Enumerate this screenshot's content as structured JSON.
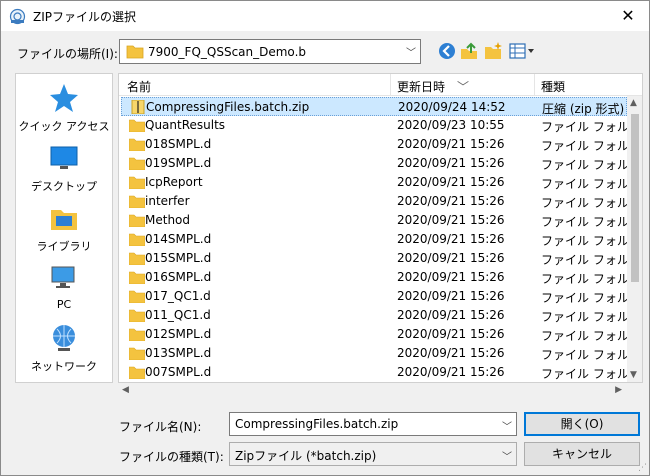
{
  "window": {
    "title": "ZIPファイルの選択",
    "close_glyph": "✕"
  },
  "lookin": {
    "label": "ファイルの場所(I):",
    "value": "7900_FQ_QSScan_Demo.b"
  },
  "places": [
    {
      "label": "クイック アクセス",
      "icon": "star-icon"
    },
    {
      "label": "デスクトップ",
      "icon": "desktop-icon"
    },
    {
      "label": "ライブラリ",
      "icon": "library-icon"
    },
    {
      "label": "PC",
      "icon": "pc-icon"
    },
    {
      "label": "ネットワーク",
      "icon": "network-icon"
    }
  ],
  "columns": {
    "name": "名前",
    "date": "更新日時",
    "type": "種類"
  },
  "files": [
    {
      "name": "CompressingFiles.batch.zip",
      "date": "2020/09/24 14:52",
      "type": "圧縮 (zip 形式) フォ",
      "kind": "zip",
      "selected": true
    },
    {
      "name": "QuantResults",
      "date": "2020/09/23 10:55",
      "type": "ファイル フォルダー",
      "kind": "folder"
    },
    {
      "name": "018SMPL.d",
      "date": "2020/09/21 15:26",
      "type": "ファイル フォルダー",
      "kind": "folder"
    },
    {
      "name": "019SMPL.d",
      "date": "2020/09/21 15:26",
      "type": "ファイル フォルダー",
      "kind": "folder"
    },
    {
      "name": "IcpReport",
      "date": "2020/09/21 15:26",
      "type": "ファイル フォルダー",
      "kind": "folder"
    },
    {
      "name": "interfer",
      "date": "2020/09/21 15:26",
      "type": "ファイル フォルダー",
      "kind": "folder"
    },
    {
      "name": "Method",
      "date": "2020/09/21 15:26",
      "type": "ファイル フォルダー",
      "kind": "folder"
    },
    {
      "name": "014SMPL.d",
      "date": "2020/09/21 15:26",
      "type": "ファイル フォルダー",
      "kind": "folder"
    },
    {
      "name": "015SMPL.d",
      "date": "2020/09/21 15:26",
      "type": "ファイル フォルダー",
      "kind": "folder"
    },
    {
      "name": "016SMPL.d",
      "date": "2020/09/21 15:26",
      "type": "ファイル フォルダー",
      "kind": "folder"
    },
    {
      "name": "017_QC1.d",
      "date": "2020/09/21 15:26",
      "type": "ファイル フォルダー",
      "kind": "folder"
    },
    {
      "name": "011_QC1.d",
      "date": "2020/09/21 15:26",
      "type": "ファイル フォルダー",
      "kind": "folder"
    },
    {
      "name": "012SMPL.d",
      "date": "2020/09/21 15:26",
      "type": "ファイル フォルダー",
      "kind": "folder"
    },
    {
      "name": "013SMPL.d",
      "date": "2020/09/21 15:26",
      "type": "ファイル フォルダー",
      "kind": "folder"
    },
    {
      "name": "007SMPL.d",
      "date": "2020/09/21 15:26",
      "type": "ファイル フォルダー",
      "kind": "folder"
    }
  ],
  "filename": {
    "label": "ファイル名(N):",
    "value": "CompressingFiles.batch.zip"
  },
  "filetype": {
    "label": "ファイルの種類(T):",
    "value": "Zipファイル (*batch.zip)"
  },
  "buttons": {
    "open": "開く(O)",
    "cancel": "キャンセル"
  },
  "colors": {
    "selection": "#cce8ff",
    "folder": "#f4c33f",
    "accent": "#0078d7"
  }
}
